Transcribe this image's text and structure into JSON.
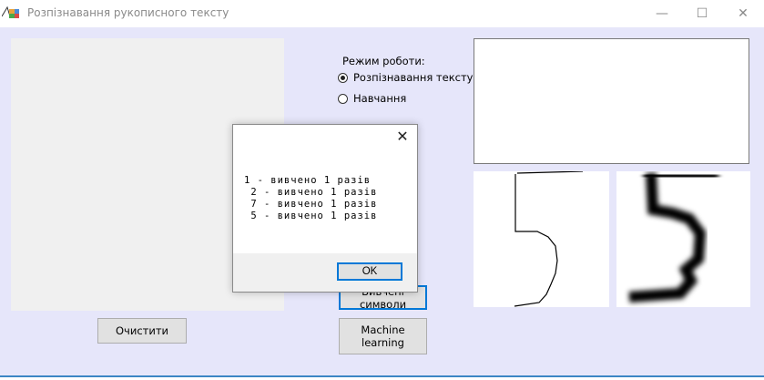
{
  "window": {
    "title": "Розпізнавання рукописного тексту",
    "minimize_glyph": "—",
    "maximize_glyph": "☐",
    "close_glyph": "✕"
  },
  "controls": {
    "clear_button": "Очистити",
    "learned_symbols_button": "Вивчені символи",
    "ml_button": "Machine learning"
  },
  "mode": {
    "label": "Режим роботи:",
    "options": [
      {
        "label": "Розпізнавання тексту",
        "selected": true
      },
      {
        "label": "Навчання",
        "selected": false
      }
    ]
  },
  "dialog": {
    "close_glyph": "✕",
    "lines": [
      "1 - вивчено 1 разів",
      " 2 - вивчено 1 разів",
      " 7 - вивчено 1 разів",
      " 5 - вивчено 1 разів"
    ],
    "ok_label": "OK"
  },
  "icons": {
    "app": "app-window-icon",
    "close": "close-icon"
  },
  "colors": {
    "background": "#e6e6fa",
    "accent": "#0078d7"
  }
}
